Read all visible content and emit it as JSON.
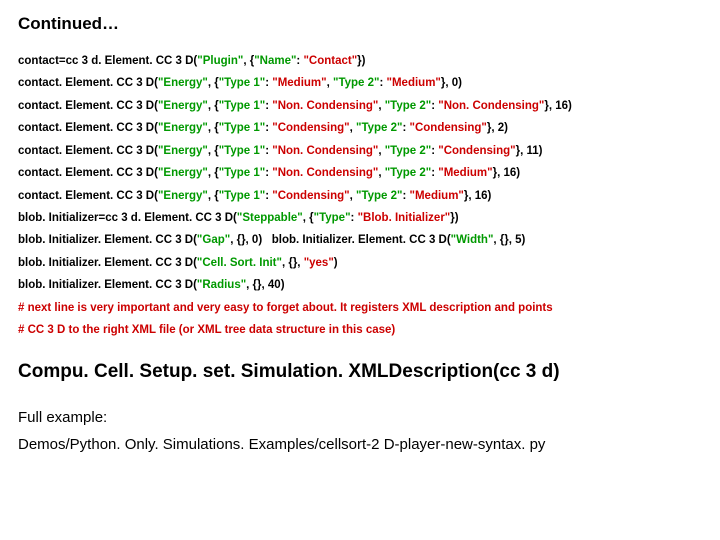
{
  "title": "Continued…",
  "lines": [
    [
      {
        "t": "contact=cc 3 d. Element. CC 3 D(",
        "c": ""
      },
      {
        "t": "\"Plugin\"",
        "c": "kw"
      },
      {
        "t": ", {",
        "c": ""
      },
      {
        "t": "\"Name\"",
        "c": "kw"
      },
      {
        "t": ": ",
        "c": ""
      },
      {
        "t": "\"Contact\"",
        "c": "str"
      },
      {
        "t": "})",
        "c": ""
      }
    ],
    [
      {
        "t": "contact. Element. CC 3 D(",
        "c": ""
      },
      {
        "t": "\"Energy\"",
        "c": "kw"
      },
      {
        "t": ", {",
        "c": ""
      },
      {
        "t": "\"Type 1\"",
        "c": "kw"
      },
      {
        "t": ": ",
        "c": ""
      },
      {
        "t": "\"Medium\"",
        "c": "str"
      },
      {
        "t": ", ",
        "c": ""
      },
      {
        "t": "\"Type 2\"",
        "c": "kw"
      },
      {
        "t": ": ",
        "c": ""
      },
      {
        "t": "\"Medium\"",
        "c": "str"
      },
      {
        "t": "}, 0)",
        "c": ""
      }
    ],
    [
      {
        "t": "contact. Element. CC 3 D(",
        "c": ""
      },
      {
        "t": "\"Energy\"",
        "c": "kw"
      },
      {
        "t": ", {",
        "c": ""
      },
      {
        "t": "\"Type 1\"",
        "c": "kw"
      },
      {
        "t": ": ",
        "c": ""
      },
      {
        "t": "\"Non. Condensing\"",
        "c": "str"
      },
      {
        "t": ", ",
        "c": ""
      },
      {
        "t": "\"Type 2\"",
        "c": "kw"
      },
      {
        "t": ": ",
        "c": ""
      },
      {
        "t": "\"Non. Condensing\"",
        "c": "str"
      },
      {
        "t": "}, 16)",
        "c": ""
      }
    ],
    [
      {
        "t": "contact. Element. CC 3 D(",
        "c": ""
      },
      {
        "t": "\"Energy\"",
        "c": "kw"
      },
      {
        "t": ", {",
        "c": ""
      },
      {
        "t": "\"Type 1\"",
        "c": "kw"
      },
      {
        "t": ": ",
        "c": ""
      },
      {
        "t": "\"Condensing\"",
        "c": "str"
      },
      {
        "t": ", ",
        "c": ""
      },
      {
        "t": "\"Type 2\"",
        "c": "kw"
      },
      {
        "t": ": ",
        "c": ""
      },
      {
        "t": "\"Condensing\"",
        "c": "str"
      },
      {
        "t": "}, 2)",
        "c": ""
      }
    ],
    [
      {
        "t": "contact. Element. CC 3 D(",
        "c": ""
      },
      {
        "t": "\"Energy\"",
        "c": "kw"
      },
      {
        "t": ", {",
        "c": ""
      },
      {
        "t": "\"Type 1\"",
        "c": "kw"
      },
      {
        "t": ": ",
        "c": ""
      },
      {
        "t": "\"Non. Condensing\"",
        "c": "str"
      },
      {
        "t": ", ",
        "c": ""
      },
      {
        "t": "\"Type 2\"",
        "c": "kw"
      },
      {
        "t": ": ",
        "c": ""
      },
      {
        "t": "\"Condensing\"",
        "c": "str"
      },
      {
        "t": "}, 11)",
        "c": ""
      }
    ],
    [
      {
        "t": "contact. Element. CC 3 D(",
        "c": ""
      },
      {
        "t": "\"Energy\"",
        "c": "kw"
      },
      {
        "t": ", {",
        "c": ""
      },
      {
        "t": "\"Type 1\"",
        "c": "kw"
      },
      {
        "t": ": ",
        "c": ""
      },
      {
        "t": "\"Non. Condensing\"",
        "c": "str"
      },
      {
        "t": ", ",
        "c": ""
      },
      {
        "t": "\"Type 2\"",
        "c": "kw"
      },
      {
        "t": ": ",
        "c": ""
      },
      {
        "t": "\"Medium\"",
        "c": "str"
      },
      {
        "t": "}, 16)",
        "c": ""
      }
    ],
    [
      {
        "t": "contact. Element. CC 3 D(",
        "c": ""
      },
      {
        "t": "\"Energy\"",
        "c": "kw"
      },
      {
        "t": ", {",
        "c": ""
      },
      {
        "t": "\"Type 1\"",
        "c": "kw"
      },
      {
        "t": ": ",
        "c": ""
      },
      {
        "t": "\"Condensing\"",
        "c": "str"
      },
      {
        "t": ", ",
        "c": ""
      },
      {
        "t": "\"Type 2\"",
        "c": "kw"
      },
      {
        "t": ": ",
        "c": ""
      },
      {
        "t": "\"Medium\"",
        "c": "str"
      },
      {
        "t": "}, 16)",
        "c": ""
      }
    ],
    [
      {
        "t": "blob. Initializer=cc 3 d. Element. CC 3 D(",
        "c": ""
      },
      {
        "t": "\"Steppable\"",
        "c": "kw"
      },
      {
        "t": ", {",
        "c": ""
      },
      {
        "t": "\"Type\"",
        "c": "kw"
      },
      {
        "t": ": ",
        "c": ""
      },
      {
        "t": "\"Blob. Initializer\"",
        "c": "str"
      },
      {
        "t": "})",
        "c": ""
      }
    ],
    [
      {
        "t": "blob. Initializer. Element. CC 3 D(",
        "c": ""
      },
      {
        "t": "\"Gap\"",
        "c": "kw"
      },
      {
        "t": ", {}, 0)   blob. Initializer. Element. CC 3 D(",
        "c": ""
      },
      {
        "t": "\"Width\"",
        "c": "kw"
      },
      {
        "t": ", {}, 5)",
        "c": ""
      }
    ],
    [
      {
        "t": "blob. Initializer. Element. CC 3 D(",
        "c": ""
      },
      {
        "t": "\"Cell. Sort. Init\"",
        "c": "kw"
      },
      {
        "t": ", {}, ",
        "c": ""
      },
      {
        "t": "\"yes\"",
        "c": "str"
      },
      {
        "t": ")",
        "c": ""
      }
    ],
    [
      {
        "t": "blob. Initializer. Element. CC 3 D(",
        "c": ""
      },
      {
        "t": "\"Radius\"",
        "c": "kw"
      },
      {
        "t": ", {}, 40)",
        "c": ""
      }
    ],
    [
      {
        "t": "# next line is very important and very easy to forget about. It registers XML description and points",
        "c": "cmt"
      }
    ],
    [
      {
        "t": "# CC 3 D to the right XML file (or XML tree data structure in this case)",
        "c": "cmt"
      }
    ]
  ],
  "api_call": "Compu. Cell. Setup. set. Simulation. XMLDescription(cc 3 d)",
  "example_label": "Full example:",
  "example_path": "Demos/Python. Only. Simulations. Examples/cellsort-2 D-player-new-syntax. py"
}
